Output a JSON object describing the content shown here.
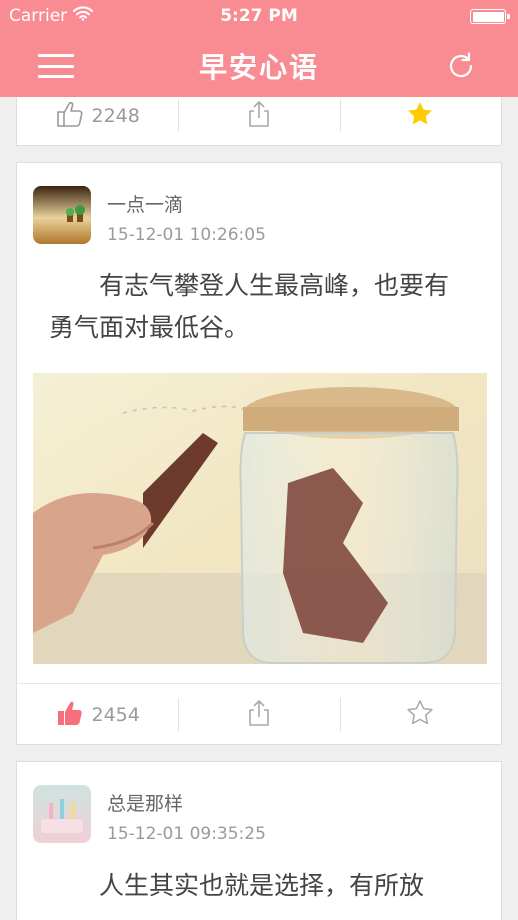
{
  "status_bar": {
    "carrier": "Carrier",
    "time": "5:27 PM"
  },
  "navbar": {
    "title": "早安心语"
  },
  "posts": [
    {
      "likes": "2248",
      "liked": false,
      "starred": true
    },
    {
      "author": "一点一滴",
      "time": "15-12-01 10:26:05",
      "text": "有志气攀登人生最高峰，也要有勇气面对最低谷。",
      "likes": "2454",
      "liked": true,
      "starred": false
    },
    {
      "author": "总是那样",
      "time": "15-12-01 09:35:25",
      "text": "人生其实也就是选择，有所放"
    }
  ],
  "colors": {
    "accent": "#f98c92",
    "star": "#ffcc00",
    "like_active": "#f5707a"
  }
}
